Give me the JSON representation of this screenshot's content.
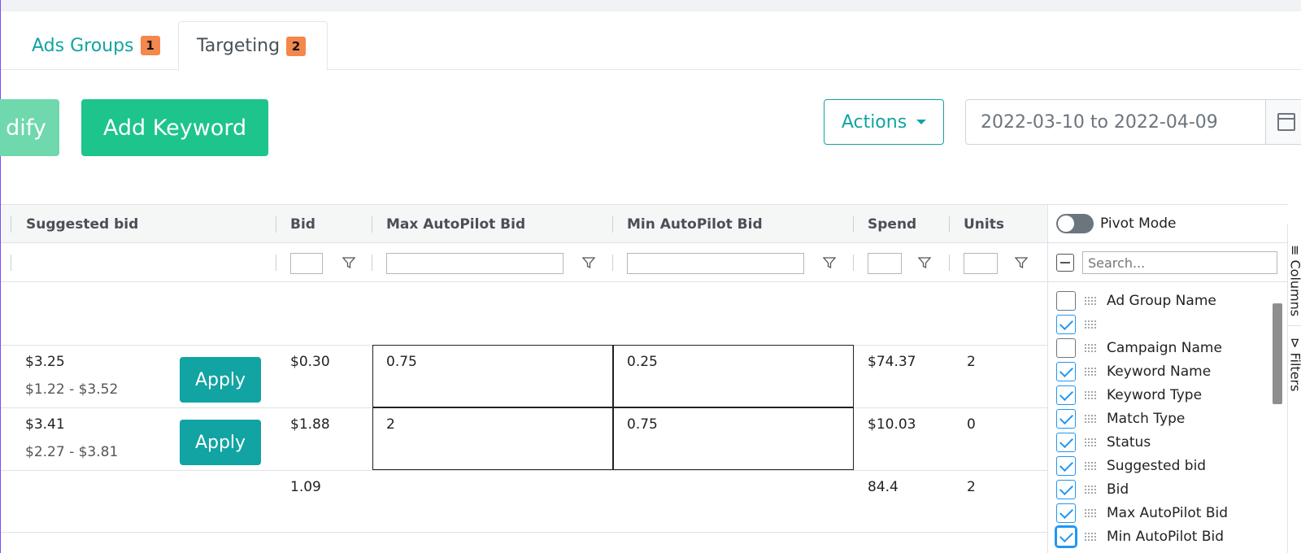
{
  "tabs": [
    {
      "label": "Ads Groups",
      "badge": "1"
    },
    {
      "label": "Targeting",
      "badge": "2"
    }
  ],
  "toolbar": {
    "modify_label": "dify",
    "add_keyword_label": "Add Keyword",
    "actions_label": "Actions",
    "date_range": "2022-03-10 to 2022-04-09"
  },
  "grid": {
    "headers": {
      "suggested_bid": "Suggested bid",
      "bid": "Bid",
      "max_autopilot_bid": "Max AutoPilot Bid",
      "min_autopilot_bid": "Min AutoPilot Bid",
      "spend": "Spend",
      "units": "Units"
    },
    "rows": [
      {
        "suggested_bid": "$3.25",
        "suggested_range": "$1.22 - $3.52",
        "apply_label": "Apply",
        "bid": "$0.30",
        "max_autopilot_bid": "0.75",
        "min_autopilot_bid": "0.25",
        "spend": "$74.37",
        "units": "2"
      },
      {
        "suggested_bid": "$3.41",
        "suggested_range": "$2.27 - $3.81",
        "apply_label": "Apply",
        "bid": "$1.88",
        "max_autopilot_bid": "2",
        "min_autopilot_bid": "0.75",
        "spend": "$10.03",
        "units": "0"
      }
    ],
    "totals": {
      "bid": "1.09",
      "spend": "84.4",
      "units": "2"
    }
  },
  "tool_panel": {
    "pivot_mode_label": "Pivot Mode",
    "search_placeholder": "Search...",
    "columns": [
      {
        "label": "Ad Group Name",
        "checked": false
      },
      {
        "label": "",
        "checked": true
      },
      {
        "label": "Campaign Name",
        "checked": false
      },
      {
        "label": "Keyword Name",
        "checked": true
      },
      {
        "label": "Keyword Type",
        "checked": true
      },
      {
        "label": "Match Type",
        "checked": true
      },
      {
        "label": "Status",
        "checked": true
      },
      {
        "label": "Suggested bid",
        "checked": true
      },
      {
        "label": "Bid",
        "checked": true
      },
      {
        "label": "Max AutoPilot Bid",
        "checked": true
      },
      {
        "label": "Min AutoPilot Bid",
        "checked": true
      }
    ],
    "side_tabs": {
      "columns": "≡ Columns",
      "filters": "⊳ Filters"
    }
  },
  "colors": {
    "teal": "#12a3a3",
    "green": "#1dc48c",
    "badge": "#f4874b",
    "checkbox": "#2196f3"
  }
}
